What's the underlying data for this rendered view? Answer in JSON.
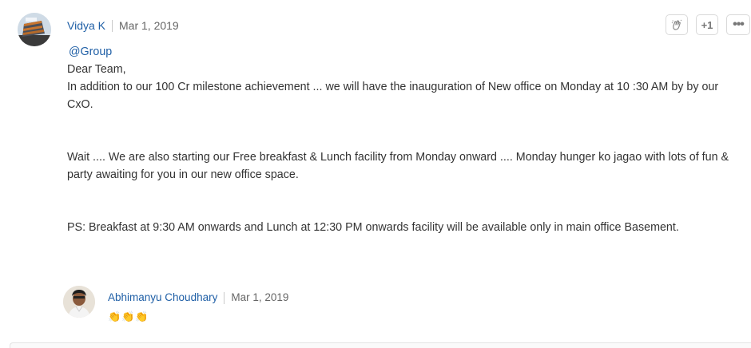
{
  "post": {
    "author": "Vidya K",
    "date": "Mar 1, 2019",
    "actions": {
      "like_icon": "clapping-hands-icon",
      "plus_one_label": "+1",
      "more_label": "•••"
    },
    "mention": "@Group",
    "greeting": " Dear Team,",
    "paragraph1": "In addition to our 100 Cr milestone achievement ... we will have the inauguration of  New office on Monday at 10 :30 AM by by our CxO.",
    "paragraph2": "Wait .... We are also starting our Free breakfast  & Lunch  facility from Monday onward .... Monday hunger ko jagao with lots of fun & party awaiting for you in our new office space.",
    "paragraph3": "PS: Breakfast at 9:30 AM onwards and Lunch at 12:30 PM onwards facility will be available only in main office Basement."
  },
  "reply": {
    "author": "Abhimanyu Choudhary",
    "date": "Mar 1, 2019",
    "reaction": "👏👏👏"
  }
}
